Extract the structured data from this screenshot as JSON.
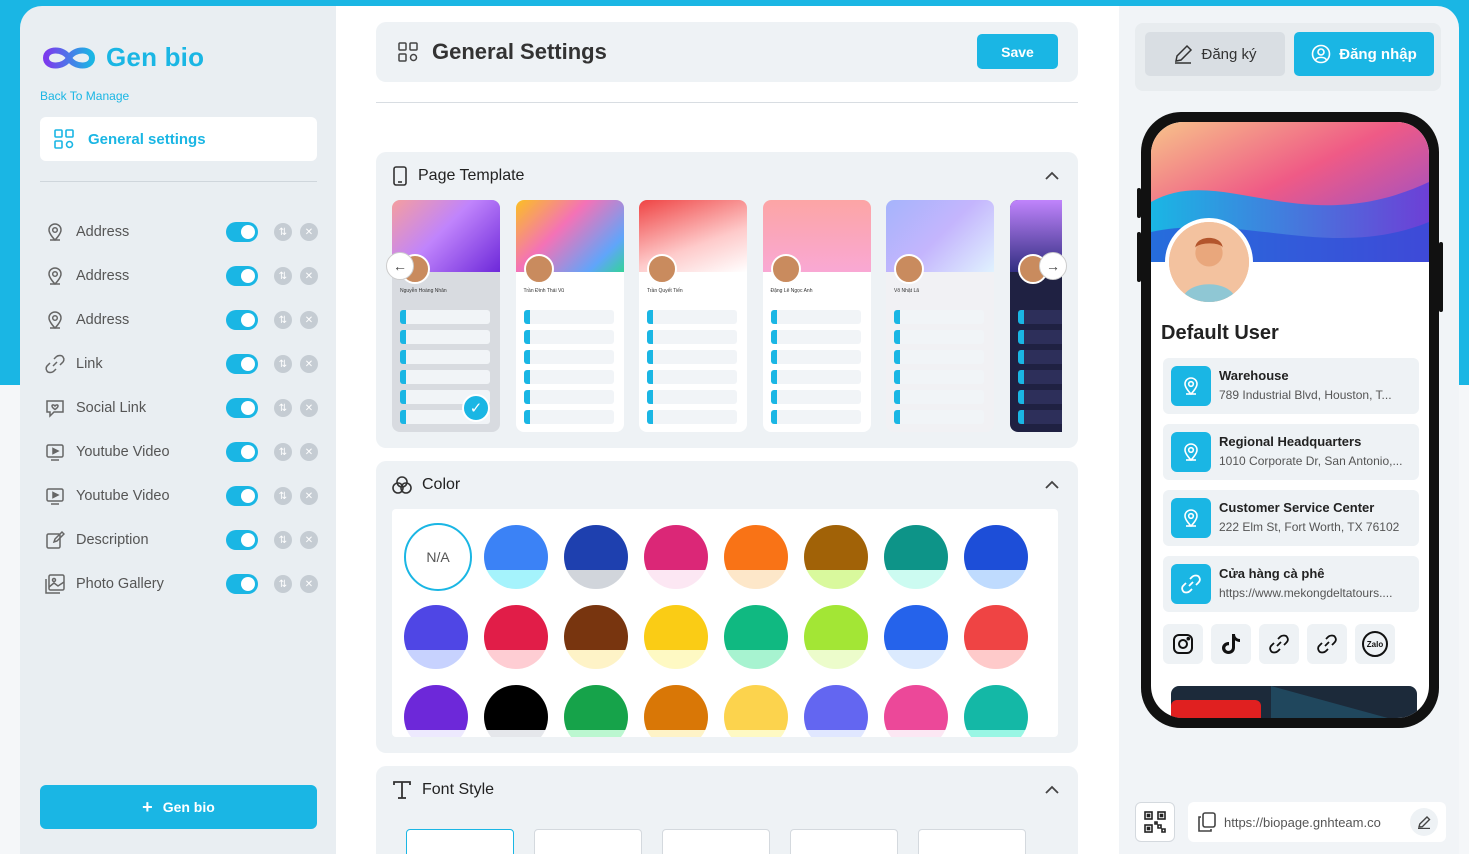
{
  "brand": {
    "name": "Gen bio",
    "back_link": "Back To Manage",
    "accent": "#1ab6e4"
  },
  "sidebar": {
    "active_item": "General settings",
    "blocks": [
      {
        "label": "Address",
        "icon": "map-pin-icon",
        "enabled": true
      },
      {
        "label": "Address",
        "icon": "map-pin-icon",
        "enabled": true
      },
      {
        "label": "Address",
        "icon": "map-pin-icon",
        "enabled": true
      },
      {
        "label": "Link",
        "icon": "link-icon",
        "enabled": true
      },
      {
        "label": "Social Link",
        "icon": "social-link-icon",
        "enabled": true
      },
      {
        "label": "Youtube Video",
        "icon": "video-icon",
        "enabled": true
      },
      {
        "label": "Youtube Video",
        "icon": "video-icon",
        "enabled": true
      },
      {
        "label": "Description",
        "icon": "edit-icon",
        "enabled": true
      },
      {
        "label": "Photo Gallery",
        "icon": "gallery-icon",
        "enabled": true
      }
    ],
    "gen_button": "Gen bio"
  },
  "header": {
    "title": "General Settings",
    "save_label": "Save"
  },
  "page_template": {
    "title": "Page Template",
    "templates": [
      {
        "name": "template-1",
        "profile": "Nguyễn Hoàng Nhân",
        "selected": true
      },
      {
        "name": "template-2",
        "profile": "Trần Đình Thái Vũ",
        "selected": false
      },
      {
        "name": "template-3",
        "profile": "Trần Quyết Tiến",
        "selected": false
      },
      {
        "name": "template-4",
        "profile": "Đặng Lê Ngọc Anh",
        "selected": false
      },
      {
        "name": "template-5",
        "profile": "Võ Nhật Lã",
        "selected": false
      },
      {
        "name": "template-6",
        "profile": "",
        "selected": false
      }
    ]
  },
  "color": {
    "title": "Color",
    "none_label": "N/A",
    "swatches": [
      [
        "#3b82f6",
        "#a5f3fc"
      ],
      [
        "#1e40af",
        "#d1d5db"
      ],
      [
        "#db2777",
        "#fce7f3"
      ],
      [
        "#f97316",
        "#fde7c9"
      ],
      [
        "#a16207",
        "#d9f99d"
      ],
      [
        "#0d9488",
        "#ccfbf1"
      ],
      [
        "#1d4ed8",
        "#bfdbfe"
      ],
      [
        "#4f46e5",
        "#c7d2fe"
      ],
      [
        "#e11d48",
        "#fecdd3"
      ],
      [
        "#78350f",
        "#fef3c7"
      ],
      [
        "#facc15",
        "#fef9c3"
      ],
      [
        "#10b981",
        "#a7f3d0"
      ],
      [
        "#a3e635",
        "#ecfccb"
      ],
      [
        "#2563eb",
        "#dbeafe"
      ],
      [
        "#ef4444",
        "#fecaca"
      ],
      [
        "#6d28d9",
        "#ede9fe"
      ],
      [
        "#000000",
        "#e5e7eb"
      ],
      [
        "#16a34a",
        "#bbf7d0"
      ],
      [
        "#d97706",
        "#fef3c7"
      ],
      [
        "#fcd34d",
        "#fef9c3"
      ],
      [
        "#6366f1",
        "#e0e7ff"
      ],
      [
        "#ec4899",
        "#fce7f3"
      ],
      [
        "#14b8a6",
        "#99f6e4"
      ]
    ]
  },
  "font_style": {
    "title": "Font Style"
  },
  "auth": {
    "register_label": "Đăng ký",
    "login_label": "Đăng nhập"
  },
  "preview": {
    "user_name": "Default User",
    "cards": [
      {
        "title": "Warehouse",
        "subtitle": "789 Industrial Blvd, Houston, T...",
        "icon": "map-pin-icon"
      },
      {
        "title": "Regional Headquarters",
        "subtitle": "1010 Corporate Dr, San Antonio,...",
        "icon": "map-pin-icon"
      },
      {
        "title": "Customer Service Center",
        "subtitle": "222 Elm St, Fort Worth, TX 76102",
        "icon": "map-pin-icon"
      },
      {
        "title": "Cửa hàng cà phê",
        "subtitle": "https://www.mekongdeltatours....",
        "icon": "link-icon"
      }
    ],
    "socials": [
      "instagram-icon",
      "tiktok-icon",
      "link-icon",
      "link-icon",
      "zalo-icon"
    ],
    "zalo_label": "Zalo",
    "url": "https://biopage.gnhteam.co"
  }
}
